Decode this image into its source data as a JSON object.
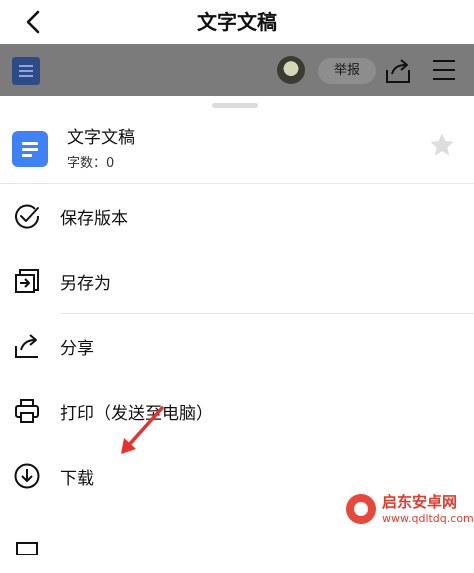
{
  "header": {
    "title": "文字文稿"
  },
  "dim_toolbar": {
    "report_label": "举报"
  },
  "sheet": {
    "doc_name": "文字文稿",
    "word_count": "字数：0",
    "items": [
      {
        "label": "保存版本",
        "icon": "check-circle-icon"
      },
      {
        "label": "另存为",
        "icon": "save-as-icon"
      },
      {
        "label": "分享",
        "icon": "share-icon"
      },
      {
        "label": "打印（发送至电脑）",
        "icon": "printer-icon"
      },
      {
        "label": "下载",
        "icon": "download-icon"
      }
    ]
  },
  "watermark": {
    "name": "启东安卓网",
    "url": "www.qdltdq.com"
  },
  "colors": {
    "doc_icon": "#3f82f5",
    "overlay": "#7b7b7b",
    "annotation_arrow": "#e8312b"
  }
}
